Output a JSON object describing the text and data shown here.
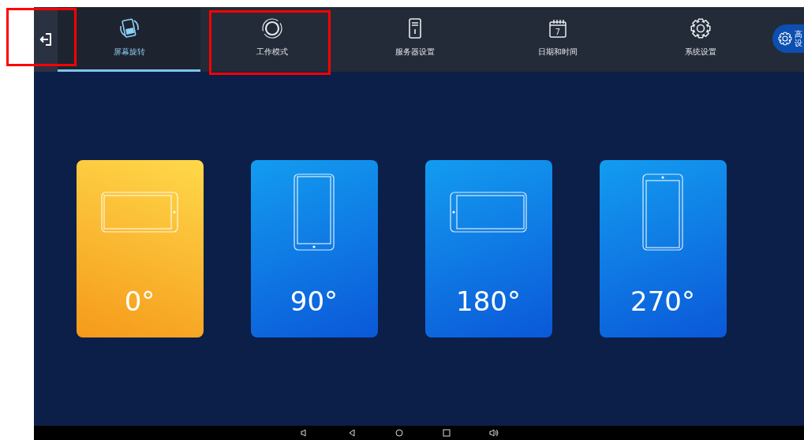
{
  "tabs": [
    {
      "label": "屏幕旋转",
      "kind": "rotate",
      "selected": true
    },
    {
      "label": "工作模式",
      "kind": "ring",
      "selected": false
    },
    {
      "label": "服务器设置",
      "kind": "server",
      "selected": false
    },
    {
      "label": "日期和时间",
      "kind": "calendar",
      "icon_text": "7",
      "selected": false
    },
    {
      "label": "系统设置",
      "kind": "gear",
      "selected": false
    }
  ],
  "advanced_button": {
    "lines": [
      "高",
      "设"
    ]
  },
  "rotations": [
    {
      "label": "0°",
      "kind": "button-right",
      "selected": true
    },
    {
      "label": "90°",
      "kind": "button-bottom",
      "selected": false
    },
    {
      "label": "180°",
      "kind": "button-left",
      "selected": false
    },
    {
      "label": "270°",
      "kind": "button-top",
      "selected": false
    }
  ]
}
